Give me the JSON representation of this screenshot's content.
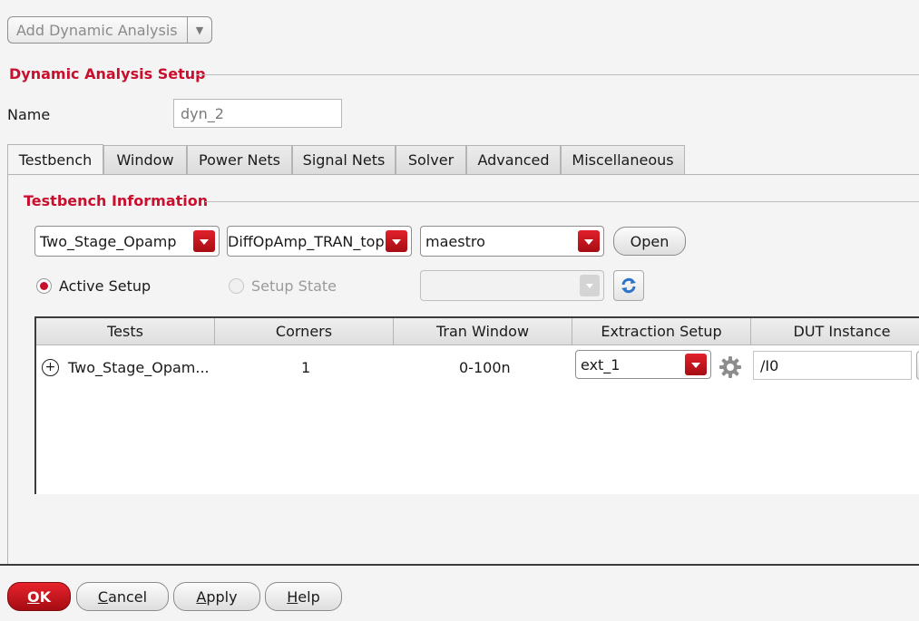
{
  "add_analysis": {
    "label": "Add Dynamic Analysis"
  },
  "setup": {
    "title": "Dynamic Analysis Setup",
    "name_label": "Name",
    "name_value": "dyn_2"
  },
  "tabs": [
    {
      "label": "Testbench"
    },
    {
      "label": "Window"
    },
    {
      "label": "Power Nets"
    },
    {
      "label": "Signal Nets"
    },
    {
      "label": "Solver"
    },
    {
      "label": "Advanced"
    },
    {
      "label": "Miscellaneous"
    }
  ],
  "testbench": {
    "title": "Testbench Information",
    "library": "Two_Stage_Opamp",
    "cell": "DiffOpAmp_TRAN_top",
    "view": "maestro",
    "open_label": "Open",
    "active_setup_label": "Active Setup",
    "setup_state_label": "Setup State"
  },
  "table": {
    "columns": [
      "Tests",
      "Corners",
      "Tran Window",
      "Extraction Setup",
      "DUT Instance"
    ],
    "rows": [
      {
        "test": "Two_Stage_Opam...",
        "corners": "1",
        "tran_window": "0-100n",
        "extraction": "ext_1",
        "dut": "/I0"
      }
    ]
  },
  "buttons": {
    "ok": {
      "u": "O",
      "rest": "K"
    },
    "cancel": {
      "u": "C",
      "rest": "ancel"
    },
    "apply": {
      "u": "A",
      "rest": "pply"
    },
    "help": {
      "u": "H",
      "rest": "elp"
    }
  },
  "colors": {
    "accent": "#c8102e",
    "background": "#f4f4f4",
    "refresh_icon": "#2a73c9"
  },
  "icons": {
    "refresh": "refresh-icon",
    "settings": "gear-icon",
    "expand": "plus-circle-icon"
  }
}
